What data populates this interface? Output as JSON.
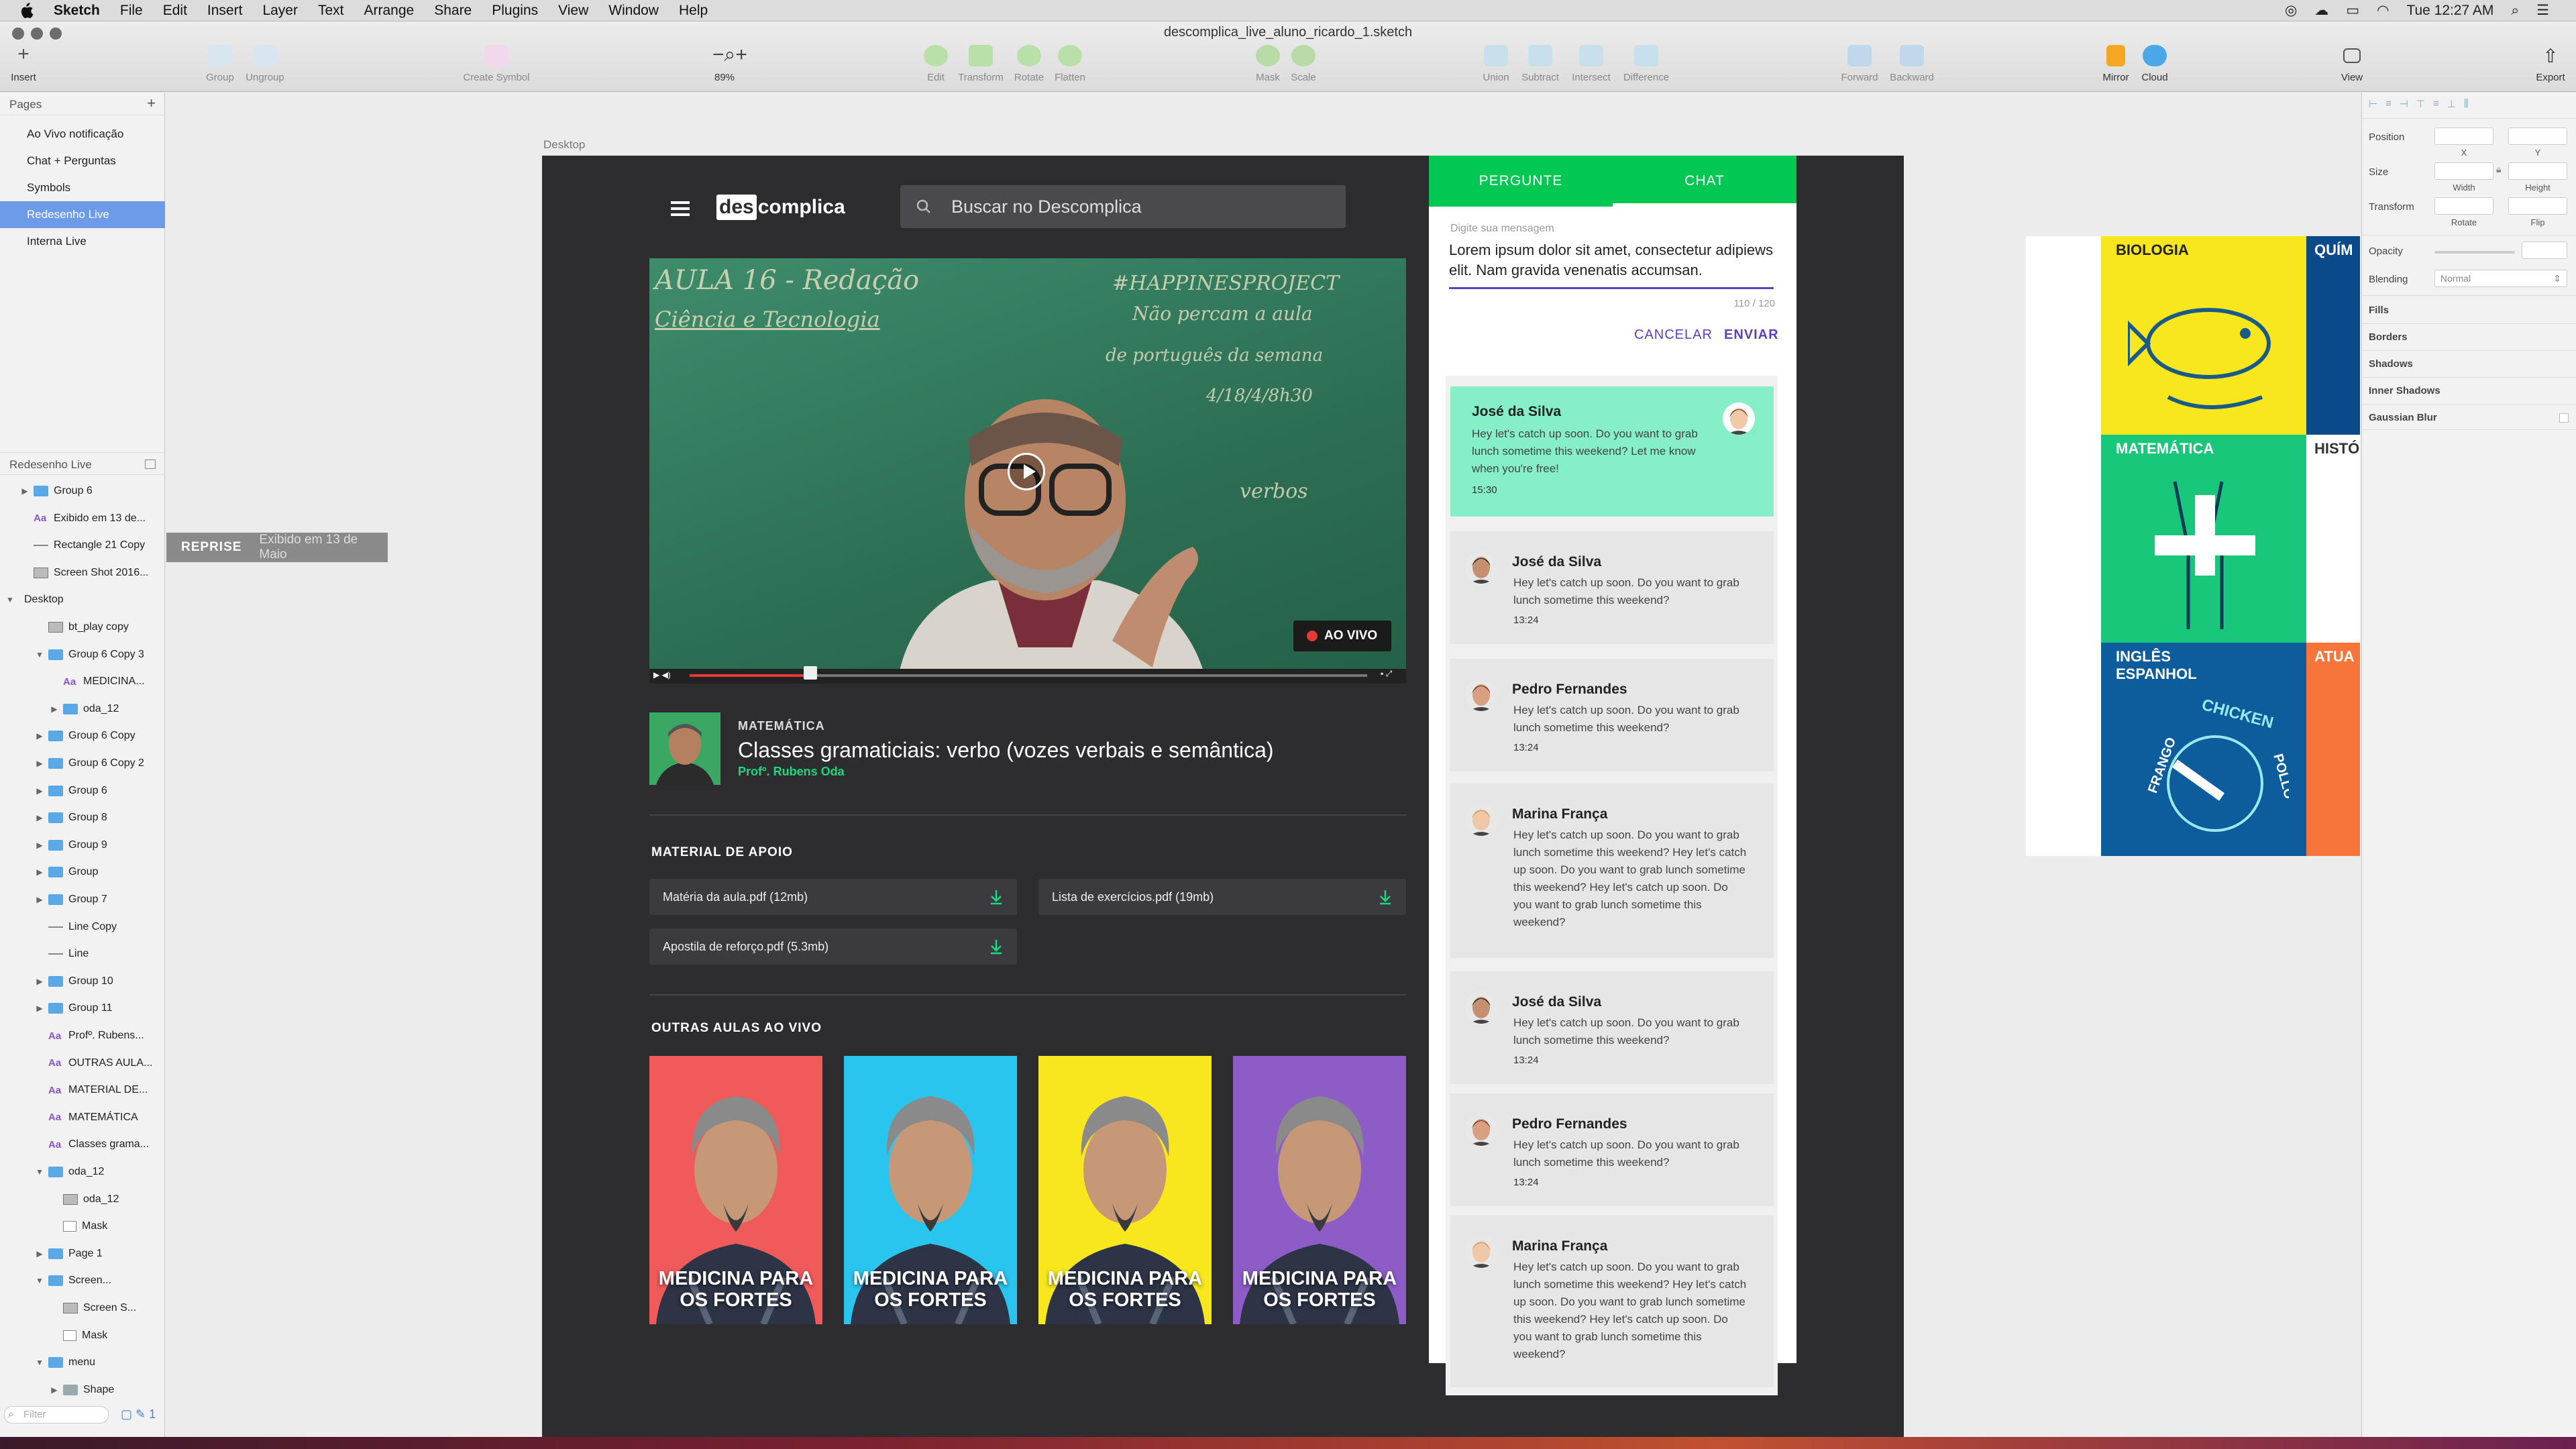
{
  "menubar": {
    "app": "Sketch",
    "items": [
      "File",
      "Edit",
      "Insert",
      "Layer",
      "Text",
      "Arrange",
      "Share",
      "Plugins",
      "View",
      "Window",
      "Help"
    ],
    "clock": "Tue 12:27 AM"
  },
  "window": {
    "title": "descomplica_live_aluno_ricardo_1.sketch"
  },
  "toolbar": {
    "insert": "Insert",
    "group": "Group",
    "ungroup": "Ungroup",
    "create_symbol": "Create Symbol",
    "zoom": "89%",
    "edit": "Edit",
    "transform": "Transform",
    "rotate": "Rotate",
    "flatten": "Flatten",
    "mask": "Mask",
    "scale": "Scale",
    "union": "Union",
    "subtract": "Subtract",
    "intersect": "Intersect",
    "difference": "Difference",
    "forward": "Forward",
    "backward": "Backward",
    "mirror": "Mirror",
    "cloud": "Cloud",
    "view": "View",
    "export": "Export"
  },
  "pages": {
    "header": "Pages",
    "items": [
      "Ao Vivo notificação",
      "Chat + Perguntas",
      "Symbols",
      "Redesenho Live",
      "Interna Live"
    ],
    "selected_index": 3
  },
  "layers": {
    "header": "Redesenho Live",
    "filter_placeholder": "Filter",
    "items": [
      {
        "label": "Group 6",
        "icon": "folder"
      },
      {
        "label": "Exibido em 13 de...",
        "icon": "text"
      },
      {
        "label": "Rectangle 21 Copy",
        "icon": "rect-line"
      },
      {
        "label": "Screen Shot 2016...",
        "icon": "image"
      },
      {
        "label": "Desktop",
        "icon": "none"
      },
      {
        "label": "bt_play copy",
        "icon": "symbol"
      },
      {
        "label": "Group 6 Copy 3",
        "icon": "folder"
      },
      {
        "label": "MEDICINA...",
        "icon": "text"
      },
      {
        "label": "oda_12",
        "icon": "folder"
      },
      {
        "label": "Group 6 Copy",
        "icon": "folder"
      },
      {
        "label": "Group 6 Copy 2",
        "icon": "folder"
      },
      {
        "label": "Group 6",
        "icon": "folder"
      },
      {
        "label": "Group 8",
        "icon": "folder"
      },
      {
        "label": "Group 9",
        "icon": "folder"
      },
      {
        "label": "Group",
        "icon": "folder"
      },
      {
        "label": "Group 7",
        "icon": "folder"
      },
      {
        "label": "Line Copy",
        "icon": "line"
      },
      {
        "label": "Line",
        "icon": "line"
      },
      {
        "label": "Group 10",
        "icon": "folder"
      },
      {
        "label": "Group 11",
        "icon": "folder"
      },
      {
        "label": "Profº. Rubens...",
        "icon": "text"
      },
      {
        "label": "OUTRAS AULA...",
        "icon": "text"
      },
      {
        "label": "MATERIAL DE...",
        "icon": "text"
      },
      {
        "label": "MATEMÁTICA",
        "icon": "text"
      },
      {
        "label": "Classes grama...",
        "icon": "text"
      },
      {
        "label": "oda_12",
        "icon": "folder"
      },
      {
        "label": "oda_12",
        "icon": "image"
      },
      {
        "label": "Mask",
        "icon": "rect"
      },
      {
        "label": "Page 1",
        "icon": "folder"
      },
      {
        "label": "Screen...",
        "icon": "folder"
      },
      {
        "label": "Screen S...",
        "icon": "image"
      },
      {
        "label": "Mask",
        "icon": "rect"
      },
      {
        "label": "menu",
        "icon": "folder"
      },
      {
        "label": "Shape",
        "icon": "shape"
      }
    ]
  },
  "tooltip": {
    "label": "REPRISE",
    "sub": "Exibido em 13 de Maio"
  },
  "artboard": {
    "name": "Desktop"
  },
  "site": {
    "logo_prefix": "des",
    "logo_suffix": "complica",
    "search_placeholder": "Buscar no Descomplica",
    "live_badge": "AO VIVO",
    "subject": "MATEMÁTICA",
    "title": "Classes gramaticiais: verbo (vozes verbais e semântica)",
    "professor": "Profº. Rubens Oda",
    "material_header": "MATERIAL DE APOIO",
    "materials": [
      "Matéria da aula.pdf (12mb)",
      "Lista de exercícios.pdf (19mb)",
      "Apostila de reforço.pdf (5.3mb)"
    ],
    "other_header": "OUTRAS AULAS AO VIVO",
    "cards": [
      {
        "title": "MEDICINA PARA OS FORTES",
        "color": "#f05a5a"
      },
      {
        "title": "MEDICINA PARA OS FORTES",
        "color": "#29c5ee"
      },
      {
        "title": "MEDICINA PARA OS FORTES",
        "color": "#f8e71c"
      },
      {
        "title": "MEDICINA PARA OS FORTES",
        "color": "#8e5cc7"
      }
    ],
    "chalk": [
      "AULA 16 - Redação",
      "Ciência e Tecnologia",
      "#HAPPINESPROJECT",
      "Não percam a aula",
      "de português da semana",
      "4/18/4/8h30",
      "verbos"
    ]
  },
  "chat": {
    "tab_ask": "PERGUNTE",
    "tab_chat": "CHAT",
    "input_label": "Digite sua mensagem",
    "input_text": "Lorem ipsum dolor sit amet, consectetur adipiews elit. Nam gravida venenatis accumsan.",
    "counter": "110 / 120",
    "cancel": "CANCELAR",
    "send": "ENVIAR",
    "messages": [
      {
        "name": "José da Silva",
        "text": "Hey let's catch up soon. Do you want to grab lunch sometime this weekend? Let me know when you're free!",
        "time": "15:30",
        "highlight": true
      },
      {
        "name": "José da Silva",
        "text": "Hey let's catch up soon. Do you want to grab lunch sometime this weekend?",
        "time": "13:24"
      },
      {
        "name": "Pedro Fernandes",
        "text": "Hey let's catch up soon. Do you want to grab lunch sometime this weekend?",
        "time": "13:24"
      },
      {
        "name": "Marina França",
        "text": "Hey let's catch up soon. Do you want to grab lunch sometime this weekend? Hey let's catch up soon. Do you want to grab lunch sometime this weekend? Hey let's catch up soon. Do you want to grab lunch sometime this weekend?",
        "time": ""
      },
      {
        "name": "José da Silva",
        "text": "Hey let's catch up soon. Do you want to grab lunch sometime this weekend?",
        "time": "13:24"
      },
      {
        "name": "Pedro Fernandes",
        "text": "Hey let's catch up soon. Do you want to grab lunch sometime this weekend?",
        "time": "13:24"
      },
      {
        "name": "Marina França",
        "text": "Hey let's catch up soon. Do you want to grab lunch sometime this weekend? Hey let's catch up soon. Do you want to grab lunch sometime this weekend? Hey let's catch up soon. Do you want to grab lunch sometime this weekend?",
        "time": ""
      }
    ]
  },
  "preview": {
    "tiles": [
      "BIOLOGIA",
      "QUÍM",
      "MATEMÁTICA",
      "HISTÓ",
      "INGLÊS ESPANHOL",
      "ATUA"
    ],
    "chicken": "CHICKEN",
    "frango": "FRANGO",
    "pollo": "POLLO"
  },
  "inspector": {
    "position": "Position",
    "size": "Size",
    "transform": "Transform",
    "x": "X",
    "y": "Y",
    "width": "Width",
    "height": "Height",
    "rotate": "Rotate",
    "flip": "Flip",
    "opacity": "Opacity",
    "blending": "Blending",
    "blending_value": "Normal",
    "fills": "Fills",
    "borders": "Borders",
    "shadows": "Shadows",
    "inner_shadows": "Inner Shadows",
    "blur": "Gaussian Blur"
  }
}
